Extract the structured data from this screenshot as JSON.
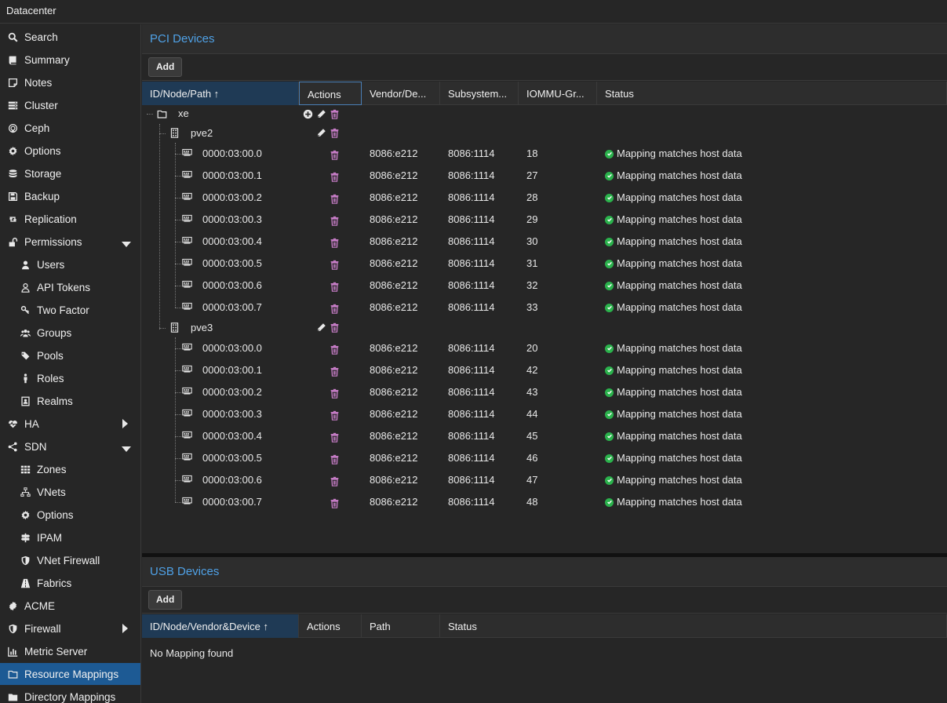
{
  "topbar": {
    "title": "Datacenter"
  },
  "sidebar": {
    "items": [
      {
        "label": "Search",
        "icon": "search-icon"
      },
      {
        "label": "Summary",
        "icon": "book-icon"
      },
      {
        "label": "Notes",
        "icon": "sticky-note-icon"
      },
      {
        "label": "Cluster",
        "icon": "server-stack-icon"
      },
      {
        "label": "Ceph",
        "icon": "ceph-icon"
      },
      {
        "label": "Options",
        "icon": "gear-icon"
      },
      {
        "label": "Storage",
        "icon": "database-icon"
      },
      {
        "label": "Backup",
        "icon": "floppy-icon"
      },
      {
        "label": "Replication",
        "icon": "retweet-icon"
      },
      {
        "label": "Permissions",
        "icon": "unlock-icon"
      },
      {
        "label": "Users",
        "icon": "user-icon"
      },
      {
        "label": "API Tokens",
        "icon": "user-outline-icon"
      },
      {
        "label": "Two Factor",
        "icon": "key-icon"
      },
      {
        "label": "Groups",
        "icon": "users-icon"
      },
      {
        "label": "Pools",
        "icon": "tags-icon"
      },
      {
        "label": "Roles",
        "icon": "male-icon"
      },
      {
        "label": "Realms",
        "icon": "address-book-icon"
      },
      {
        "label": "HA",
        "icon": "heartbeat-icon"
      },
      {
        "label": "SDN",
        "icon": "sdn-icon"
      },
      {
        "label": "Zones",
        "icon": "th-icon"
      },
      {
        "label": "VNets",
        "icon": "sitemap-icon"
      },
      {
        "label": "Options",
        "icon": "gear-icon"
      },
      {
        "label": "IPAM",
        "icon": "signs-icon"
      },
      {
        "label": "VNet Firewall",
        "icon": "shield-icon"
      },
      {
        "label": "Fabrics",
        "icon": "road-icon"
      },
      {
        "label": "ACME",
        "icon": "certificate-icon"
      },
      {
        "label": "Firewall",
        "icon": "shield-icon"
      },
      {
        "label": "Metric Server",
        "icon": "bar-chart-icon"
      },
      {
        "label": "Resource Mappings",
        "icon": "folder-icon"
      },
      {
        "label": "Directory Mappings",
        "icon": "folder-solid-icon"
      }
    ]
  },
  "pci": {
    "title": "PCI Devices",
    "add_label": "Add",
    "columns": [
      "ID/Node/Path ↑",
      "Actions",
      "Vendor/De...",
      "Subsystem...",
      "IOMMU-Gr...",
      "Status"
    ],
    "group": "xe",
    "nodes": [
      {
        "name": "pve2",
        "devices": [
          {
            "path": "0000:03:00.0",
            "vendor": "8086:e212",
            "subsystem": "8086:1114",
            "iommu": "18",
            "status": "Mapping matches host data"
          },
          {
            "path": "0000:03:00.1",
            "vendor": "8086:e212",
            "subsystem": "8086:1114",
            "iommu": "27",
            "status": "Mapping matches host data"
          },
          {
            "path": "0000:03:00.2",
            "vendor": "8086:e212",
            "subsystem": "8086:1114",
            "iommu": "28",
            "status": "Mapping matches host data"
          },
          {
            "path": "0000:03:00.3",
            "vendor": "8086:e212",
            "subsystem": "8086:1114",
            "iommu": "29",
            "status": "Mapping matches host data"
          },
          {
            "path": "0000:03:00.4",
            "vendor": "8086:e212",
            "subsystem": "8086:1114",
            "iommu": "30",
            "status": "Mapping matches host data"
          },
          {
            "path": "0000:03:00.5",
            "vendor": "8086:e212",
            "subsystem": "8086:1114",
            "iommu": "31",
            "status": "Mapping matches host data"
          },
          {
            "path": "0000:03:00.6",
            "vendor": "8086:e212",
            "subsystem": "8086:1114",
            "iommu": "32",
            "status": "Mapping matches host data"
          },
          {
            "path": "0000:03:00.7",
            "vendor": "8086:e212",
            "subsystem": "8086:1114",
            "iommu": "33",
            "status": "Mapping matches host data"
          }
        ]
      },
      {
        "name": "pve3",
        "devices": [
          {
            "path": "0000:03:00.0",
            "vendor": "8086:e212",
            "subsystem": "8086:1114",
            "iommu": "20",
            "status": "Mapping matches host data"
          },
          {
            "path": "0000:03:00.1",
            "vendor": "8086:e212",
            "subsystem": "8086:1114",
            "iommu": "42",
            "status": "Mapping matches host data"
          },
          {
            "path": "0000:03:00.2",
            "vendor": "8086:e212",
            "subsystem": "8086:1114",
            "iommu": "43",
            "status": "Mapping matches host data"
          },
          {
            "path": "0000:03:00.3",
            "vendor": "8086:e212",
            "subsystem": "8086:1114",
            "iommu": "44",
            "status": "Mapping matches host data"
          },
          {
            "path": "0000:03:00.4",
            "vendor": "8086:e212",
            "subsystem": "8086:1114",
            "iommu": "45",
            "status": "Mapping matches host data"
          },
          {
            "path": "0000:03:00.5",
            "vendor": "8086:e212",
            "subsystem": "8086:1114",
            "iommu": "46",
            "status": "Mapping matches host data"
          },
          {
            "path": "0000:03:00.6",
            "vendor": "8086:e212",
            "subsystem": "8086:1114",
            "iommu": "47",
            "status": "Mapping matches host data"
          },
          {
            "path": "0000:03:00.7",
            "vendor": "8086:e212",
            "subsystem": "8086:1114",
            "iommu": "48",
            "status": "Mapping matches host data"
          }
        ]
      }
    ]
  },
  "usb": {
    "title": "USB Devices",
    "add_label": "Add",
    "columns": [
      "ID/Node/Vendor&Device ↑",
      "Actions",
      "Path",
      "Status"
    ],
    "empty_text": "No Mapping found"
  },
  "colors": {
    "accent": "#4fa1e6",
    "selected": "#1d5a94",
    "ok": "#2bb24c",
    "trash": "#c77dc7"
  }
}
